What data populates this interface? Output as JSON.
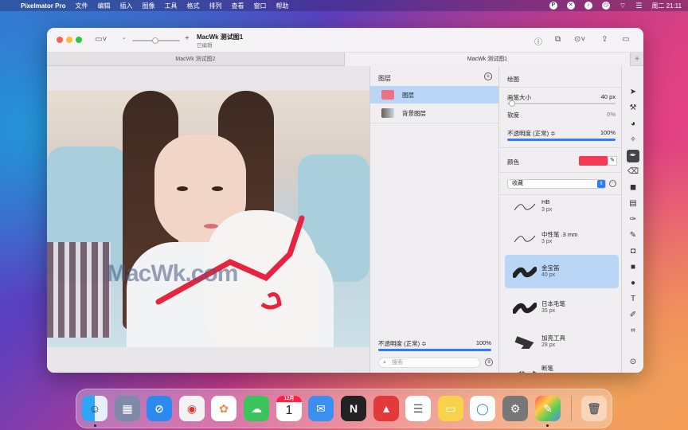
{
  "menubar": {
    "app": "Pixelmator Pro",
    "items": [
      "文件",
      "编辑",
      "插入",
      "图像",
      "工具",
      "格式",
      "排列",
      "查看",
      "窗口",
      "帮助"
    ],
    "clock": "周二 21:11"
  },
  "window": {
    "title": "MacWk 测试图1",
    "subtitle": "已编辑",
    "zoom_minus": "-",
    "zoom_plus": "+"
  },
  "tabs": [
    "MacWk 测试图2",
    "MacWk 测试图1"
  ],
  "canvas": {
    "watermark": "MacWk.com"
  },
  "layers": {
    "header": "图层",
    "items": [
      {
        "name": "图层"
      },
      {
        "name": "背景图层"
      }
    ],
    "opacity_label": "不透明度 (正常) ≎",
    "opacity_value": "100%",
    "search_placeholder": "搜索"
  },
  "paint": {
    "header": "绘图",
    "brush_size_label": "画笔大小",
    "brush_size_value": "40 px",
    "softness_label": "软度",
    "softness_value": "0%",
    "opacity_label": "不透明度 (正常) ≎",
    "opacity_value": "100%",
    "color_label": "颜色",
    "color_value": "#f23a55",
    "collection": "收藏",
    "brushes": [
      {
        "name": "HB",
        "size": "3 px"
      },
      {
        "name": "中性笔 .3 mm",
        "size": "3 px"
      },
      {
        "name": "金宝笛",
        "size": "40 px"
      },
      {
        "name": "日本毛笔",
        "size": "35 px"
      },
      {
        "name": "加亮工具",
        "size": "28 px"
      },
      {
        "name": "断笔",
        "size": ""
      }
    ]
  },
  "dock": {
    "calendar_month": "12月",
    "calendar_day": "1"
  }
}
